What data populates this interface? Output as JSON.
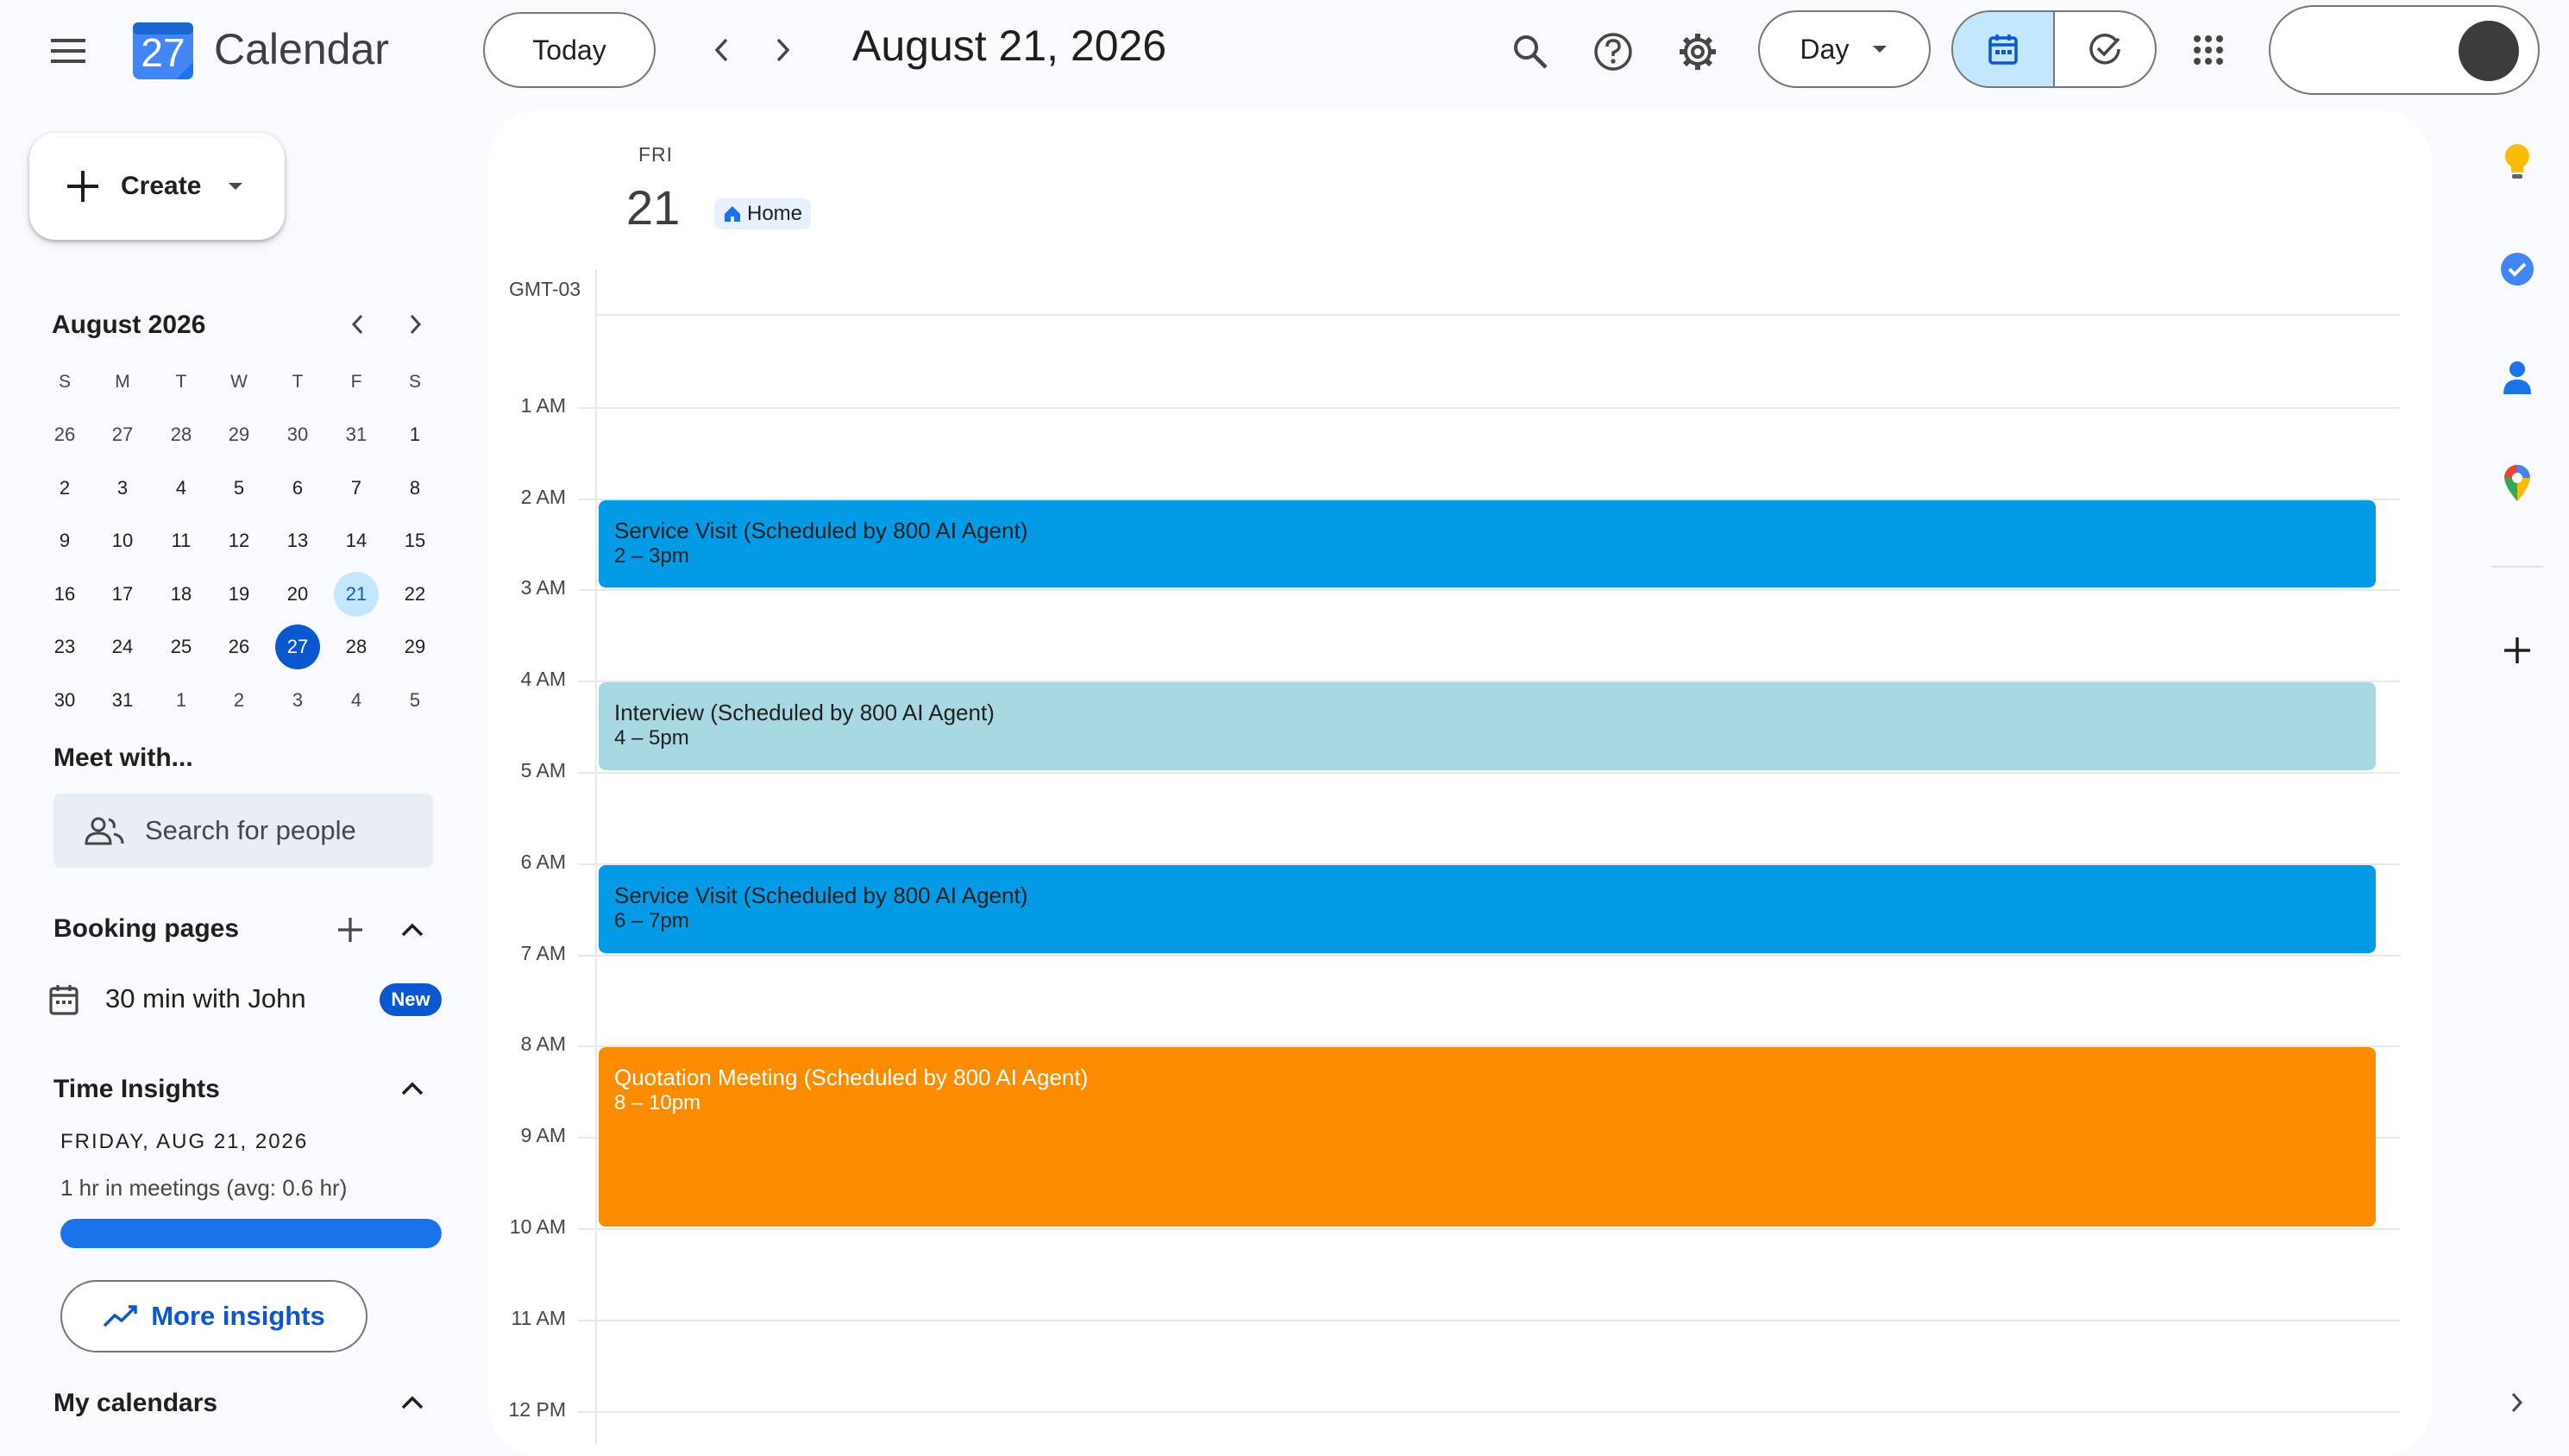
{
  "header": {
    "app_title": "Calendar",
    "logo_day": "27",
    "today_label": "Today",
    "current_date": "August 21, 2026",
    "view_label": "Day"
  },
  "sidebar": {
    "create_label": "Create",
    "mini_calendar": {
      "title": "August 2026",
      "weekdays": [
        "S",
        "M",
        "T",
        "W",
        "T",
        "F",
        "S"
      ],
      "weeks": [
        [
          "26",
          "27",
          "28",
          "29",
          "30",
          "31",
          "1"
        ],
        [
          "2",
          "3",
          "4",
          "5",
          "6",
          "7",
          "8"
        ],
        [
          "9",
          "10",
          "11",
          "12",
          "13",
          "14",
          "15"
        ],
        [
          "16",
          "17",
          "18",
          "19",
          "20",
          "21",
          "22"
        ],
        [
          "23",
          "24",
          "25",
          "26",
          "27",
          "28",
          "29"
        ],
        [
          "30",
          "31",
          "1",
          "2",
          "3",
          "4",
          "5"
        ]
      ],
      "selected_day": "21",
      "today_day": "27"
    },
    "meet_with": {
      "title": "Meet with...",
      "search_placeholder": "Search for people"
    },
    "booking_pages": {
      "title": "Booking pages",
      "item_label": "30 min with John",
      "badge": "New"
    },
    "time_insights": {
      "title": "Time Insights",
      "date": "FRIDAY, AUG 21, 2026",
      "summary": "1 hr in meetings (avg: 0.6 hr)",
      "bar_fill": 1.0,
      "more_label": "More insights"
    },
    "my_calendars": {
      "title": "My calendars"
    }
  },
  "day_view": {
    "weekday": "FRI",
    "day_number": "21",
    "location_chip": "Home",
    "timezone": "GMT-03",
    "hour_labels": [
      "1 AM",
      "2 AM",
      "3 AM",
      "4 AM",
      "5 AM",
      "6 AM",
      "7 AM",
      "8 AM",
      "9 AM",
      "10 AM",
      "11 AM",
      "12 PM"
    ]
  },
  "events": [
    {
      "title": "Service Visit (Scheduled by 800 AI Agent)",
      "time": "2 – 3pm",
      "color": "#039be5",
      "text_color": "#1f1f1f"
    },
    {
      "title": "Interview (Scheduled by 800 AI Agent)",
      "time": "4 – 5pm",
      "color": "#a8d8e2",
      "text_color": "#1f1f1f"
    },
    {
      "title": "Service Visit (Scheduled by 800 AI Agent)",
      "time": "6 – 7pm",
      "color": "#039be5",
      "text_color": "#1f1f1f"
    },
    {
      "title": "Quotation Meeting (Scheduled by 800 AI Agent)",
      "time": "8 – 10pm",
      "color": "#fb8c00",
      "text_color": "#ffffff"
    }
  ],
  "colors": {
    "accent": "#0b57d0",
    "selected_bg": "#c2e7ff",
    "panel_bg": "#ffffff",
    "page_bg": "#f8fafd"
  }
}
